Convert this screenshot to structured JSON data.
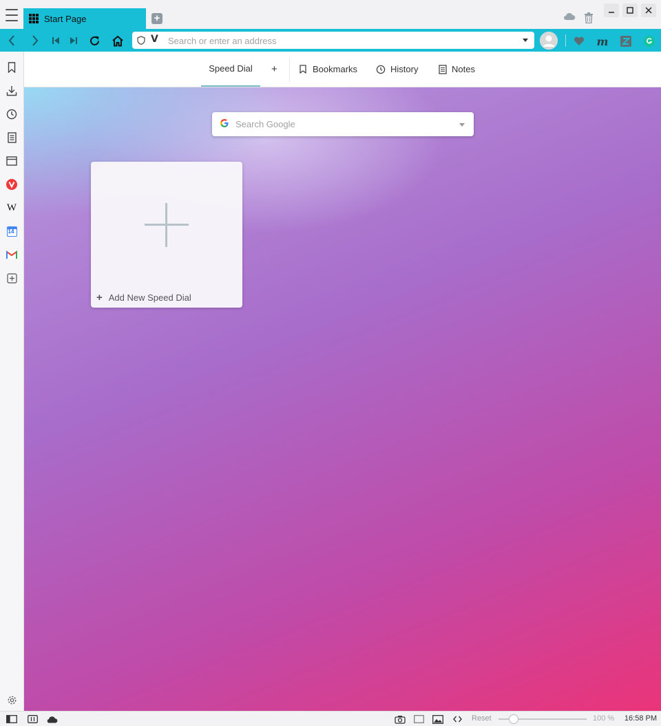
{
  "window": {
    "tab_title": "Start Page",
    "icons": [
      "menu-icon",
      "speed-dial-grid-icon",
      "new-tab-icon",
      "sync-cloud-icon",
      "trash-icon",
      "minimize-icon",
      "maximize-icon",
      "close-icon"
    ]
  },
  "toolbar": {
    "address_placeholder": "Search or enter an address",
    "address_value": "",
    "icons": [
      "back-icon",
      "forward-icon",
      "rewind-icon",
      "fast-forward-icon",
      "reload-icon",
      "home-icon",
      "shield-icon",
      "vivaldi-v-icon",
      "profile-avatar",
      "heart-extension-icon",
      "m-extension-icon",
      "z-extension-icon",
      "grammarly-extension-icon"
    ]
  },
  "sidebar": {
    "panels": [
      "bookmarks-panel",
      "downloads-panel",
      "history-panel",
      "notes-panel",
      "window-panel",
      "vivaldi-panel",
      "wikipedia-panel",
      "calendar-panel",
      "gmail-panel",
      "add-web-panel"
    ],
    "wikipedia_glyph": "W",
    "calendar_day": "14"
  },
  "startpage": {
    "nav": {
      "speed_dial": "Speed Dial",
      "add": "+",
      "bookmarks": "Bookmarks",
      "history": "History",
      "notes": "Notes"
    },
    "search_placeholder": "Search Google",
    "add_dial_label": "Add New Speed Dial"
  },
  "statusbar": {
    "reset": "Reset",
    "zoom": "100 %",
    "time": "16:58 PM"
  },
  "colors": {
    "accent": "#18bdd6",
    "background_gradient": [
      "#9ddcf5",
      "#b89ae0",
      "#a86cca",
      "#c04aa8",
      "#ea3479"
    ]
  }
}
